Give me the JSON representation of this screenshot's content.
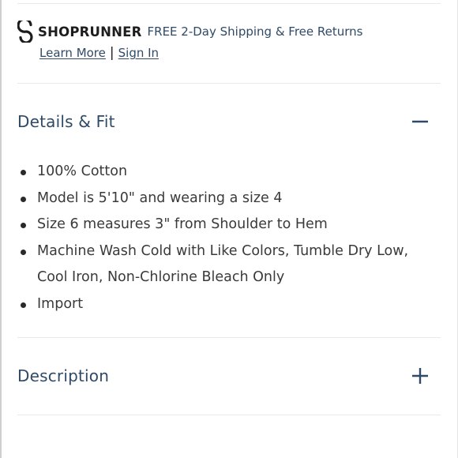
{
  "shoprunner": {
    "brand": "SHOPRUNNER",
    "promo": "FREE 2-Day Shipping & Free Returns",
    "learn_more": "Learn More",
    "separator": "|",
    "sign_in": "Sign In",
    "logo_icon": "shoprunner-s-icon"
  },
  "details": {
    "title": "Details & Fit",
    "toggle_icon": "minus-icon",
    "items": [
      "100% Cotton",
      "Model is 5'10\" and wearing a size 4",
      "Size 6 measures 3\" from Shoulder to Hem",
      "Machine Wash Cold with Like Colors, Tumble Dry Low, Cool Iron, Non-Chlorine Bleach Only",
      "Import"
    ]
  },
  "description": {
    "title": "Description",
    "toggle_icon": "plus-icon"
  },
  "colors": {
    "accent": "#2f4a66",
    "text": "#3a3a3a",
    "divider": "#e9e9e9"
  }
}
